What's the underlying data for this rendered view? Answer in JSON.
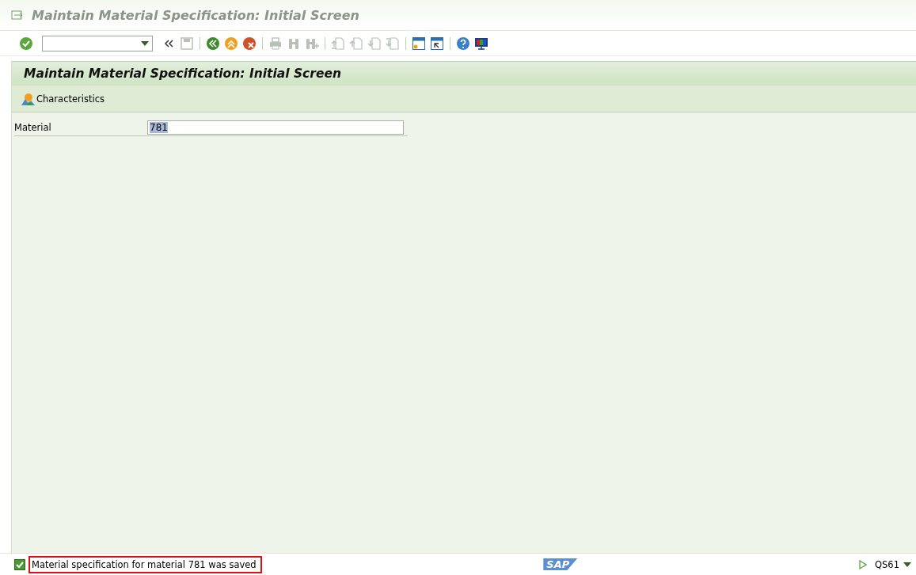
{
  "window": {
    "title": "Maintain Material Specification: Initial Screen"
  },
  "toolbar": [
    {
      "kind": "enter",
      "disabled": false
    },
    {
      "kind": "command-field"
    },
    {
      "kind": "collapse",
      "disabled": false
    },
    {
      "kind": "save",
      "disabled": true
    },
    {
      "kind": "separator"
    },
    {
      "kind": "back",
      "disabled": false
    },
    {
      "kind": "exit",
      "disabled": false
    },
    {
      "kind": "cancel",
      "disabled": false
    },
    {
      "kind": "separator"
    },
    {
      "kind": "print",
      "disabled": true
    },
    {
      "kind": "find",
      "disabled": true
    },
    {
      "kind": "find-next",
      "disabled": true
    },
    {
      "kind": "separator"
    },
    {
      "kind": "first-page",
      "disabled": true
    },
    {
      "kind": "prev-page",
      "disabled": true
    },
    {
      "kind": "next-page",
      "disabled": true
    },
    {
      "kind": "last-page",
      "disabled": true
    },
    {
      "kind": "separator"
    },
    {
      "kind": "new-session",
      "disabled": false
    },
    {
      "kind": "shortcut",
      "disabled": false
    },
    {
      "kind": "separator"
    },
    {
      "kind": "help",
      "disabled": false
    },
    {
      "kind": "layout",
      "disabled": false
    }
  ],
  "screen": {
    "title": "Maintain Material Specification: Initial Screen",
    "app_toolbar": [
      {
        "label": "Characteristics"
      }
    ],
    "fields": [
      {
        "label": "Material",
        "value": "781",
        "selected": true
      }
    ]
  },
  "status_bar": {
    "message": "Material specification for material 781 was saved",
    "success": true,
    "logo": "SAP",
    "system": "QS61"
  }
}
